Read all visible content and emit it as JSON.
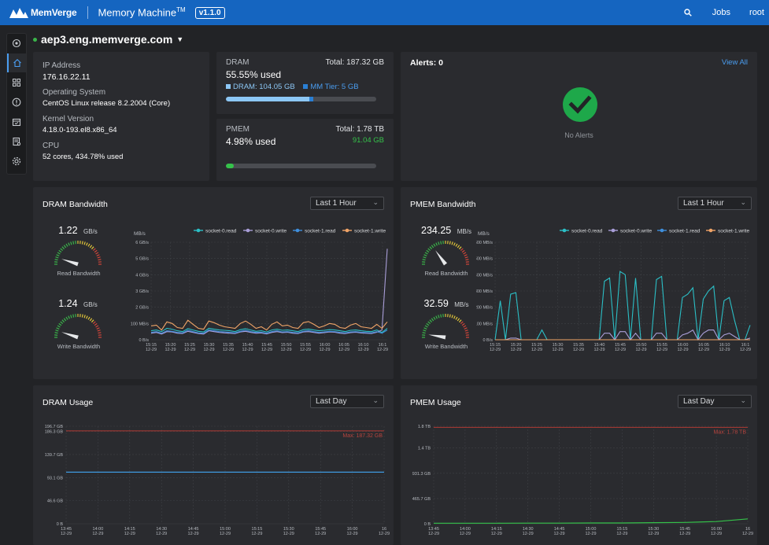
{
  "topbar": {
    "brand": "MemVerge",
    "product": "Memory Machine",
    "product_tm": "TM",
    "version": "v1.1.0",
    "jobs_label": "Jobs",
    "user_label": "root"
  },
  "host": {
    "name": "aep3.eng.memverge.com",
    "status_color": "#3ab54a"
  },
  "sidebar": {
    "items": [
      {
        "icon": "cluster-icon"
      },
      {
        "icon": "home-icon",
        "active": true
      },
      {
        "icon": "grid-icon"
      },
      {
        "icon": "alert-icon"
      },
      {
        "icon": "calendar-icon"
      },
      {
        "icon": "report-icon"
      },
      {
        "icon": "gear-icon"
      }
    ]
  },
  "system_info": {
    "ip_label": "IP Address",
    "ip_value": "176.16.22.11",
    "os_label": "Operating System",
    "os_value": "CentOS Linux release 8.2.2004 (Core)",
    "kernel_label": "Kernel Version",
    "kernel_value": "4.18.0-193.el8.x86_64",
    "cpu_label": "CPU",
    "cpu_value": "52 cores, 434.78% used"
  },
  "dram": {
    "label": "DRAM",
    "total": "Total: 187.32 GB",
    "used": "55.55% used",
    "dram_legend": "DRAM: 104.05 GB",
    "mmtier_legend": "MM Tier: 5 GB",
    "dram_fraction": 0.5555,
    "mmtier_fraction": 0.027,
    "dram_color": "#8cc7f5",
    "mmtier_color": "#2a7fd4"
  },
  "pmem": {
    "label": "PMEM",
    "total": "Total: 1.78 TB",
    "used": "4.98% used",
    "used_amount": "91.04 GB",
    "fraction": 0.0498,
    "color": "#35c24a"
  },
  "alerts": {
    "title": "Alerts: 0",
    "view_all": "View All",
    "empty_text": "No Alerts",
    "ok_color": "#1ea84a"
  },
  "dram_bandwidth": {
    "title": "DRAM Bandwidth",
    "range": "Last 1 Hour",
    "read_value": "1.22",
    "read_unit": "GB/s",
    "read_label": "Read Bandwidth",
    "write_value": "1.24",
    "write_unit": "GB/s",
    "write_label": "Write Bandwidth"
  },
  "pmem_bandwidth": {
    "title": "PMEM Bandwidth",
    "range": "Last 1 Hour",
    "read_value": "234.25",
    "read_unit": "MB/s",
    "read_label": "Read Bandwidth",
    "write_value": "32.59",
    "write_unit": "MB/s",
    "write_label": "Write Bandwidth"
  },
  "dram_usage": {
    "title": "DRAM Usage",
    "range": "Last Day"
  },
  "pmem_usage": {
    "title": "PMEM Usage",
    "range": "Last Day"
  },
  "chart_data": [
    {
      "id": "dram-bw",
      "type": "line",
      "ylabel": "MB/s",
      "yticks": [
        "0 B/s",
        "100 MB/s",
        "2 GB/s",
        "3 GB/s",
        "4 GB/s",
        "5 GB/s",
        "6 GB/s"
      ],
      "xticks": [
        "15:15",
        "15:20",
        "15:25",
        "15:30",
        "15:35",
        "15:40",
        "15:45",
        "15:50",
        "15:55",
        "16:00",
        "16:05",
        "16:10",
        "16:1"
      ],
      "xsub": "12-29",
      "legend_position": "top-right",
      "grid": true,
      "series": [
        {
          "name": "socket-0.read",
          "color": "#2bbfc6",
          "values": [
            55,
            60,
            50,
            70,
            65,
            55,
            50,
            68,
            60,
            52,
            48,
            70,
            65,
            60,
            58,
            55,
            50,
            62,
            68,
            60,
            52,
            55,
            48,
            60,
            65,
            58,
            60,
            55,
            50,
            62,
            66,
            60,
            55,
            58,
            62,
            60,
            55,
            50,
            58,
            60,
            55,
            52,
            50,
            60,
            45,
            70
          ]
        },
        {
          "name": "socket-0.write",
          "color": "#a99ed8",
          "values": [
            40,
            45,
            35,
            50,
            48,
            40,
            38,
            52,
            45,
            38,
            35,
            55,
            50,
            45,
            42,
            40,
            38,
            48,
            52,
            45,
            40,
            42,
            36,
            45,
            50,
            44,
            46,
            40,
            38,
            48,
            50,
            45,
            40,
            44,
            48,
            46,
            40,
            38,
            44,
            46,
            42,
            40,
            38,
            46,
            60,
            560
          ]
        },
        {
          "name": "socket-1.read",
          "color": "#3f8fdc",
          "values": [
            45,
            50,
            40,
            55,
            52,
            45,
            42,
            58,
            50,
            42,
            40,
            60,
            55,
            50,
            48,
            45,
            42,
            52,
            58,
            50,
            45,
            46,
            40,
            50,
            55,
            48,
            50,
            45,
            42,
            52,
            56,
            50,
            45,
            48,
            52,
            50,
            45,
            42,
            48,
            50,
            46,
            44,
            42,
            50,
            40,
            60
          ]
        },
        {
          "name": "socket-1.write",
          "color": "#f0a467",
          "values": [
            85,
            90,
            60,
            110,
            100,
            75,
            70,
            120,
            95,
            70,
            65,
            115,
            105,
            90,
            80,
            75,
            70,
            100,
            115,
            95,
            70,
            80,
            60,
            95,
            110,
            85,
            90,
            75,
            70,
            105,
            112,
            95,
            75,
            85,
            100,
            95,
            75,
            70,
            90,
            100,
            80,
            75,
            70,
            95,
            70,
            110
          ]
        }
      ]
    },
    {
      "id": "pmem-bw",
      "type": "line",
      "ylabel": "MB/s",
      "yticks": [
        "0 B/s",
        "100 MB/s",
        "200 MB/s",
        "300 MB/s",
        "400 MB/s",
        "500 MB/s",
        "600 MB/s"
      ],
      "xticks": [
        "15:15",
        "15:20",
        "15:25",
        "15:30",
        "15:35",
        "15:40",
        "15:45",
        "15:50",
        "15:55",
        "16:00",
        "16:05",
        "16:10",
        "16:1"
      ],
      "xsub": "12-29",
      "legend_position": "top-right",
      "grid": true,
      "series": [
        {
          "name": "socket-0.read",
          "color": "#2bbfc6",
          "values": [
            0,
            240,
            0,
            280,
            290,
            0,
            0,
            0,
            0,
            60,
            0,
            0,
            0,
            0,
            0,
            0,
            0,
            0,
            0,
            0,
            0,
            360,
            380,
            0,
            420,
            400,
            0,
            380,
            0,
            0,
            0,
            370,
            390,
            0,
            0,
            0,
            260,
            280,
            320,
            0,
            250,
            300,
            330,
            0,
            240,
            260,
            120,
            0,
            0,
            90
          ]
        },
        {
          "name": "socket-0.write",
          "color": "#a99ed8",
          "values": [
            0,
            0,
            0,
            10,
            10,
            0,
            0,
            0,
            0,
            0,
            0,
            0,
            0,
            0,
            0,
            0,
            0,
            0,
            0,
            0,
            0,
            40,
            40,
            0,
            50,
            50,
            0,
            40,
            0,
            0,
            0,
            40,
            40,
            0,
            0,
            0,
            30,
            40,
            60,
            0,
            40,
            60,
            60,
            0,
            30,
            40,
            20,
            0,
            0,
            10
          ]
        },
        {
          "name": "socket-1.read",
          "color": "#3f8fdc",
          "values": [
            0,
            0,
            0,
            0,
            0,
            0,
            0,
            0,
            0,
            0,
            0,
            0,
            0,
            0,
            0,
            0,
            0,
            0,
            0,
            0,
            0,
            0,
            0,
            0,
            0,
            0,
            0,
            0,
            0,
            0,
            0,
            0,
            0,
            0,
            0,
            0,
            0,
            0,
            0,
            0,
            0,
            0,
            0,
            0,
            0,
            0,
            0,
            0,
            0,
            0
          ]
        },
        {
          "name": "socket-1.write",
          "color": "#f0a467",
          "values": [
            0,
            0,
            0,
            0,
            0,
            0,
            0,
            0,
            0,
            0,
            0,
            0,
            0,
            0,
            0,
            0,
            0,
            0,
            0,
            0,
            0,
            0,
            0,
            0,
            0,
            0,
            0,
            0,
            0,
            0,
            0,
            0,
            0,
            0,
            0,
            0,
            0,
            0,
            0,
            0,
            0,
            0,
            0,
            0,
            0,
            0,
            0,
            0,
            0,
            0
          ]
        }
      ]
    },
    {
      "id": "dram-usage",
      "type": "line",
      "yticks": [
        "0 B",
        "46.6 GB",
        "93.1 GB",
        "139.7 GB",
        "186.3 GB",
        "196.7 GB"
      ],
      "xticks": [
        "13:45",
        "14:00",
        "14:15",
        "14:30",
        "14:45",
        "15:00",
        "15:15",
        "15:30",
        "15:45",
        "16:00",
        "16"
      ],
      "xsub": "12-29",
      "max_label": "Max: 187.32 GB",
      "max_color": "#b03a34",
      "grid": true,
      "series": [
        {
          "name": "",
          "color": "#3f9ae0",
          "values": [
            104.05,
            104.05,
            104.05,
            104.05,
            104.05,
            104.05,
            104.05,
            104.05,
            104.05,
            104.05,
            104.05
          ]
        }
      ]
    },
    {
      "id": "pmem-usage",
      "type": "line",
      "yticks": [
        "0 B",
        "465.7 GB",
        "931.3 GB",
        "1.4 TB",
        "1.8 TB"
      ],
      "xticks": [
        "13:45",
        "14:00",
        "14:15",
        "14:30",
        "14:45",
        "15:00",
        "15:15",
        "15:30",
        "15:45",
        "16:00",
        "16"
      ],
      "xsub": "12-29",
      "max_label": "Max: 1.78 TB",
      "max_color": "#b03a34",
      "grid": true,
      "series": [
        {
          "name": "",
          "color": "#35c24a",
          "values": [
            0.01,
            0.01,
            0.01,
            0.012,
            0.012,
            0.015,
            0.015,
            0.02,
            0.025,
            0.04,
            0.09
          ]
        }
      ]
    }
  ]
}
